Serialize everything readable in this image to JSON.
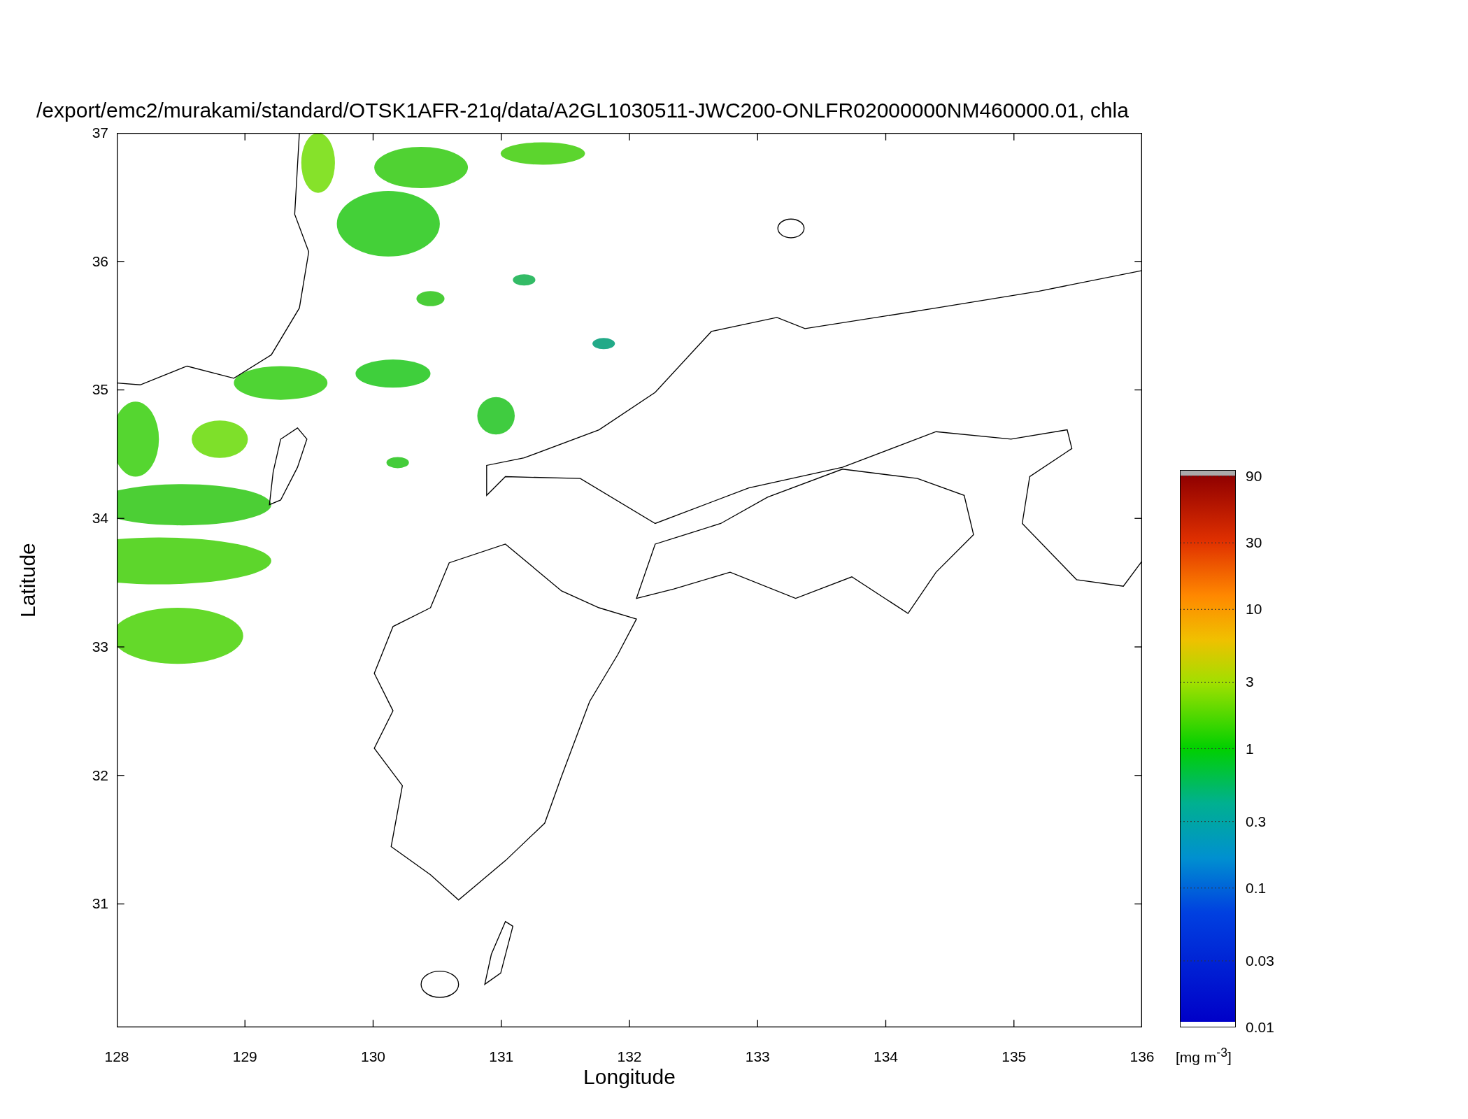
{
  "title": "/export/emc2/murakami/standard/OTSK1AFR-21q/data/A2GL1030511-JWC200-ONLFR02000000NM460000.01, chla",
  "x_axis": {
    "label": "Longitude",
    "ticks": [
      "128",
      "129",
      "130",
      "131",
      "132",
      "133",
      "134",
      "135",
      "136"
    ]
  },
  "y_axis": {
    "label": "Latitude",
    "ticks": [
      "37",
      "36",
      "35",
      "34",
      "33",
      "32",
      "31"
    ]
  },
  "colorbar": {
    "ticks": [
      "90",
      "30",
      "10",
      "3",
      "1",
      "0.3",
      "0.1",
      "0.03",
      "0.01"
    ],
    "unit": "[mg m$^{-3}$]"
  }
}
